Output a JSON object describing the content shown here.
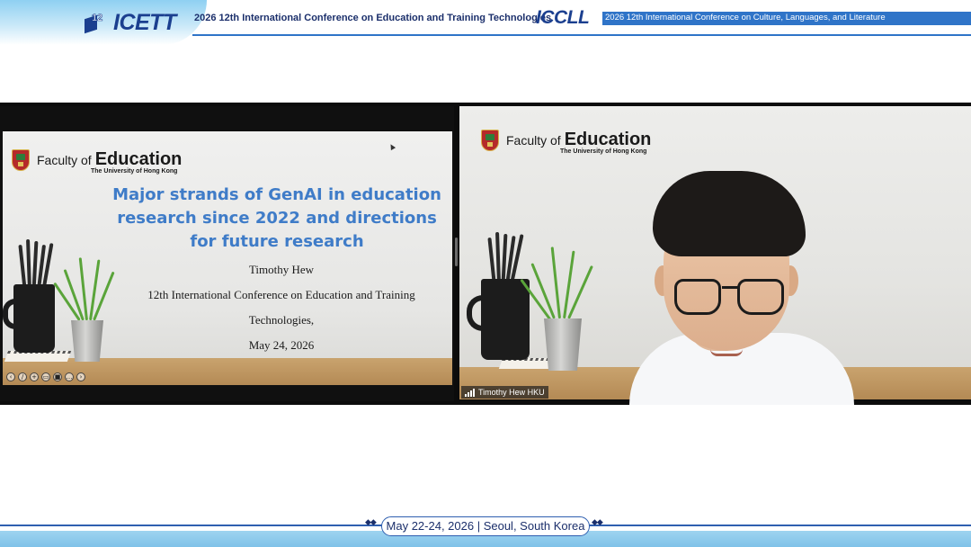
{
  "header": {
    "icett_logo_number": "12",
    "icett_logo_text": "ICETT",
    "icett_title": "2026 12th International Conference on Education and Training Technologies",
    "iccll_logo_text": "ICCLL",
    "iccll_title": "2026 12th International Conference on Culture, Languages, and Literature",
    "accent_color": "#2f74c8",
    "brand_color": "#1b3f8f"
  },
  "slide": {
    "faculty_prefix": "Faculty of",
    "faculty_name": "Education",
    "university": "The University of Hong Kong",
    "title": "Major strands of GenAI in education research since 2022 and directions for future research",
    "author": "Timothy Hew",
    "conference_line1": "12th International Conference on Education and Training",
    "conference_line2": "Technologies,",
    "date": "May 24, 2026",
    "title_color": "#3f7cc8",
    "controls": [
      "prev-icon",
      "pen-icon",
      "zoom-icon",
      "captions-icon",
      "video-icon",
      "menu-icon",
      "next-icon"
    ]
  },
  "camera": {
    "faculty_prefix": "Faculty of",
    "faculty_name": "Education",
    "university": "The University of Hong Kong",
    "participant_name": "Timothy Hew HKU",
    "signal_icon": "signal-bars-icon"
  },
  "footer": {
    "event_info": "May 22-24, 2026 | Seoul, South Korea",
    "left_ornament": "◆◆",
    "right_ornament": "◆◆"
  }
}
